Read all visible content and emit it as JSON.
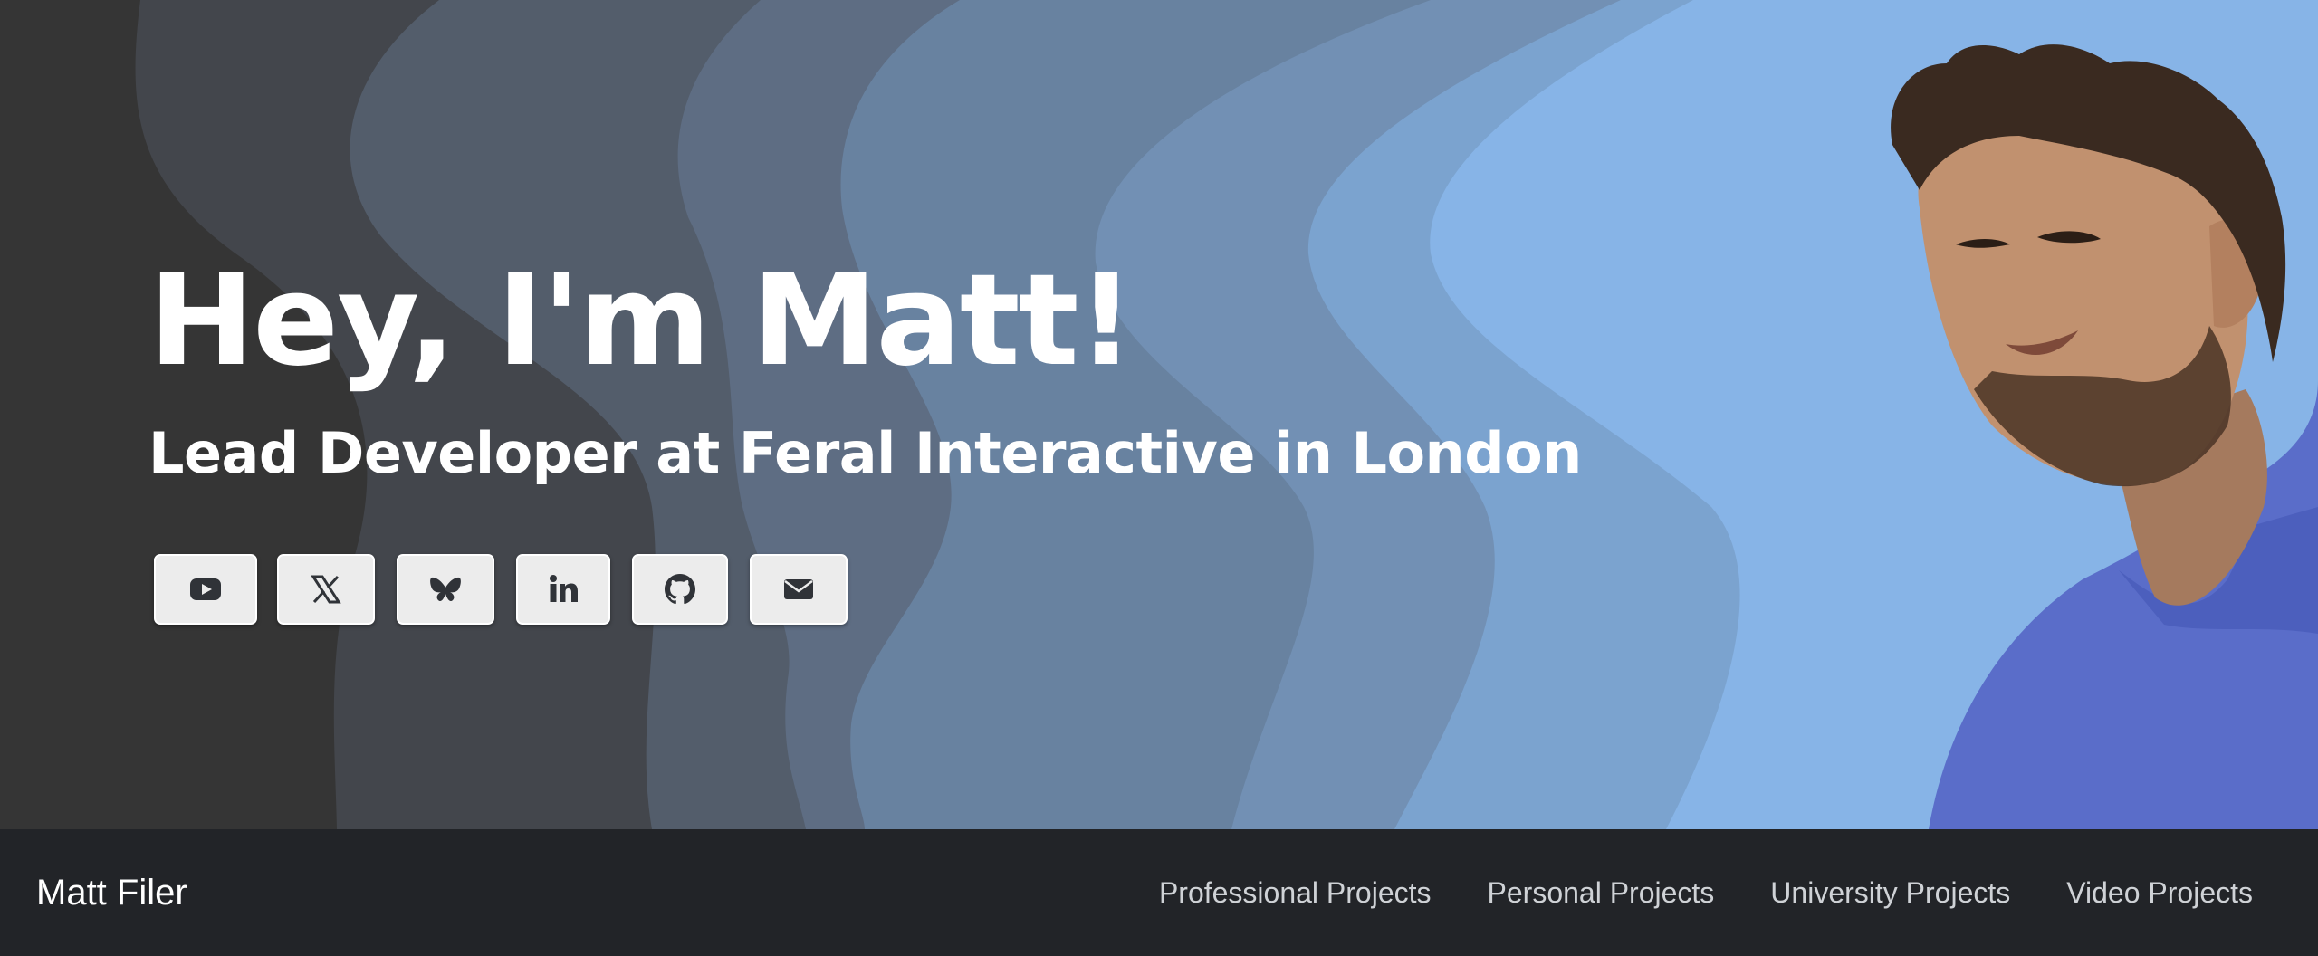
{
  "hero": {
    "title": "Hey, I'm Matt!",
    "subtitle": "Lead Developer at Feral Interactive in London",
    "wave_colors": [
      "#353535",
      "#43464c",
      "#535d6b",
      "#607088",
      "#6a83a0",
      "#7392b8",
      "#7ea6d2",
      "#87b4e6"
    ],
    "portrait_alt": "portrait-photo"
  },
  "social": [
    {
      "name": "youtube",
      "icon": "youtube-icon"
    },
    {
      "name": "x",
      "icon": "x-icon"
    },
    {
      "name": "bluesky",
      "icon": "bluesky-icon"
    },
    {
      "name": "linkedin",
      "icon": "linkedin-icon"
    },
    {
      "name": "github",
      "icon": "github-icon"
    },
    {
      "name": "email",
      "icon": "mail-icon"
    }
  ],
  "navbar": {
    "brand": "Matt Filer",
    "links": [
      "Professional Projects",
      "Personal Projects",
      "University Projects",
      "Video Projects"
    ]
  }
}
